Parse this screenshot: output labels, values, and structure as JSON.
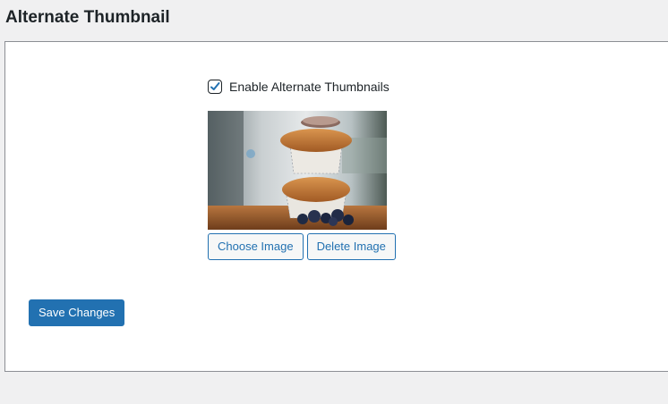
{
  "page": {
    "title": "Alternate Thumbnail"
  },
  "settings": {
    "enable_checked": true,
    "enable_label": "Enable Alternate Thumbnails",
    "image_description": "",
    "choose_label": "Choose Image",
    "delete_label": "Delete Image",
    "save_label": "Save Changes"
  },
  "colors": {
    "accent": "#2271b1",
    "background": "#f0f0f1",
    "panel": "#ffffff",
    "text": "#1d2327"
  }
}
